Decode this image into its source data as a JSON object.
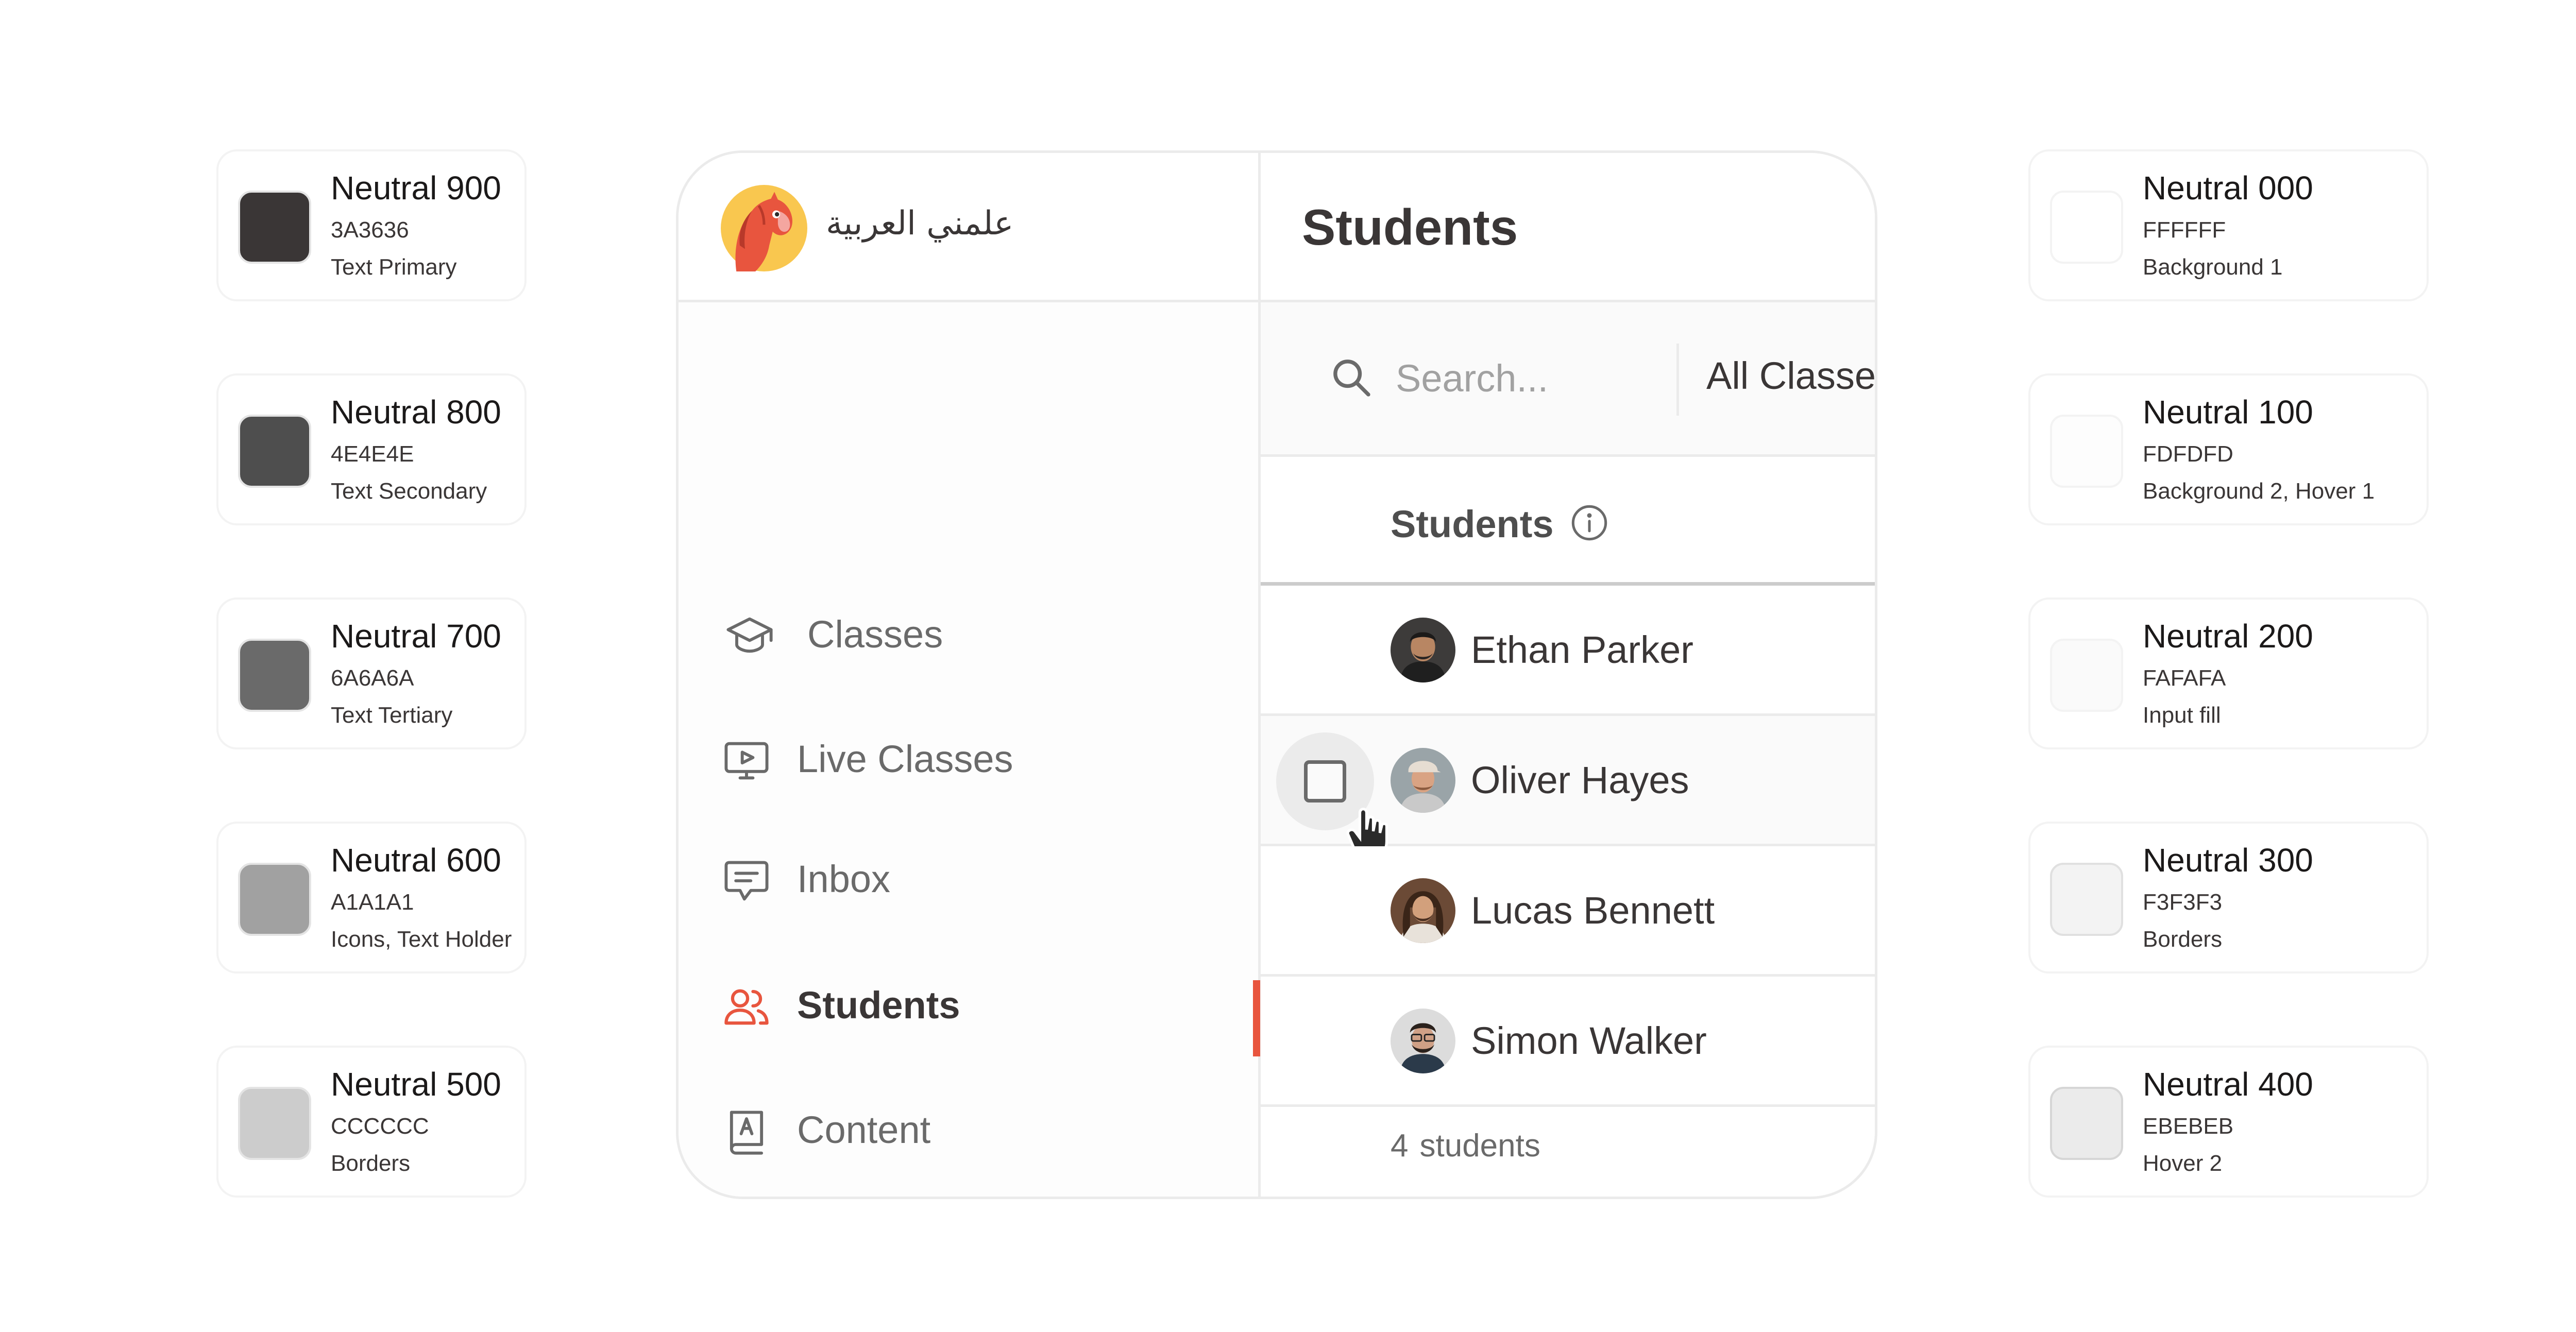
{
  "palette_left": [
    {
      "name": "Neutral 900",
      "hex": "3A3636",
      "role": "Text Primary",
      "color": "#3A3636"
    },
    {
      "name": "Neutral 800",
      "hex": "4E4E4E",
      "role": "Text Secondary",
      "color": "#4E4E4E"
    },
    {
      "name": "Neutral 700",
      "hex": "6A6A6A",
      "role": "Text Tertiary",
      "color": "#6A6A6A"
    },
    {
      "name": "Neutral 600",
      "hex": "A1A1A1",
      "role": "Icons, Text Holder",
      "color": "#A1A1A1"
    },
    {
      "name": "Neutral 500",
      "hex": "CCCCCC",
      "role": "Borders",
      "color": "#CCCCCC"
    }
  ],
  "palette_right": [
    {
      "name": "Neutral 000",
      "hex": "FFFFFF",
      "role": "Background 1",
      "color": "#FFFFFF"
    },
    {
      "name": "Neutral 100",
      "hex": "FDFDFD",
      "role": "Background 2, Hover 1",
      "color": "#FDFDFD"
    },
    {
      "name": "Neutral 200",
      "hex": "FAFAFA",
      "role": "Input fill",
      "color": "#FAFAFA"
    },
    {
      "name": "Neutral 300",
      "hex": "F3F3F3",
      "role": "Borders",
      "color": "#F3F3F3"
    },
    {
      "name": "Neutral 400",
      "hex": "EBEBEB",
      "role": "Hover 2",
      "color": "#EBEBEB"
    }
  ],
  "app": {
    "brand": {
      "name": "علمني العربية",
      "logo_icon": "horse-logo-icon"
    },
    "nav": [
      {
        "label": "Classes",
        "icon": "graduation-cap-icon",
        "active": false
      },
      {
        "label": "Live Classes",
        "icon": "video-play-icon",
        "active": false
      },
      {
        "label": "Inbox",
        "icon": "chat-bubble-icon",
        "active": false
      },
      {
        "label": "Students",
        "icon": "users-icon",
        "active": true
      },
      {
        "label": "Content",
        "icon": "book-icon",
        "active": false
      }
    ],
    "page_title": "Students",
    "search": {
      "placeholder": "Search...",
      "value": ""
    },
    "filter": {
      "selected": "All Classe"
    },
    "table": {
      "column_header": "Students",
      "rows": [
        {
          "name": "Ethan Parker"
        },
        {
          "name": "Oliver Hayes"
        },
        {
          "name": "Lucas Bennett"
        },
        {
          "name": "Simon Walker"
        }
      ]
    },
    "footer": {
      "count": "4",
      "unit": "students"
    }
  },
  "colors": {
    "accent": "#E8553E",
    "logo_bg": "#F9C74F"
  }
}
